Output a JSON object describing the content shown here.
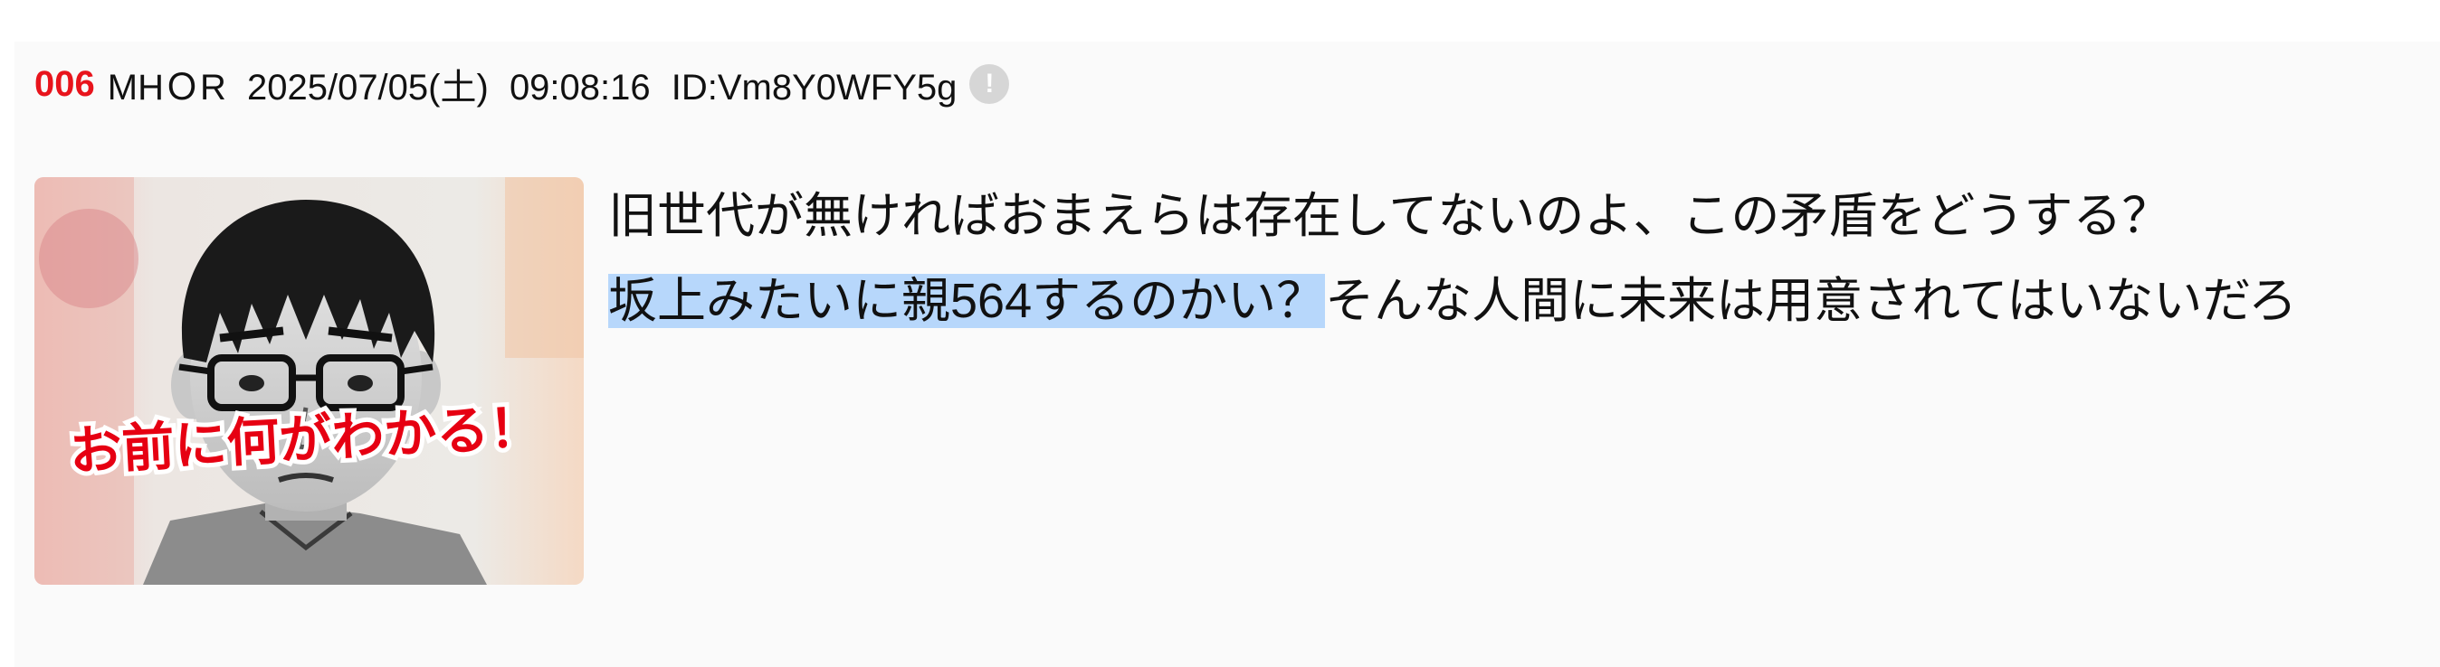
{
  "post": {
    "number": "006",
    "name": "MHＯR",
    "date": "2025/07/05(土)",
    "time": "09:08:16",
    "id": "ID:Vm8Y0WFY5g",
    "report_icon": "exclamation-circle-icon",
    "thumbnail": {
      "caption": "お前に何がわかる！",
      "caption_color": "#e60012"
    },
    "body": {
      "line1": "旧世代が無ければおまえらは存在してないのよ、この矛盾をどうする？",
      "line2_selected": "坂上みたいに親564するのかい？",
      "line2_rest": "そんな人間に未来は用意されてはいないだろ"
    },
    "colors": {
      "number": "#e8141c",
      "selection": "#b7d7fb",
      "background": "#fafafa"
    }
  }
}
